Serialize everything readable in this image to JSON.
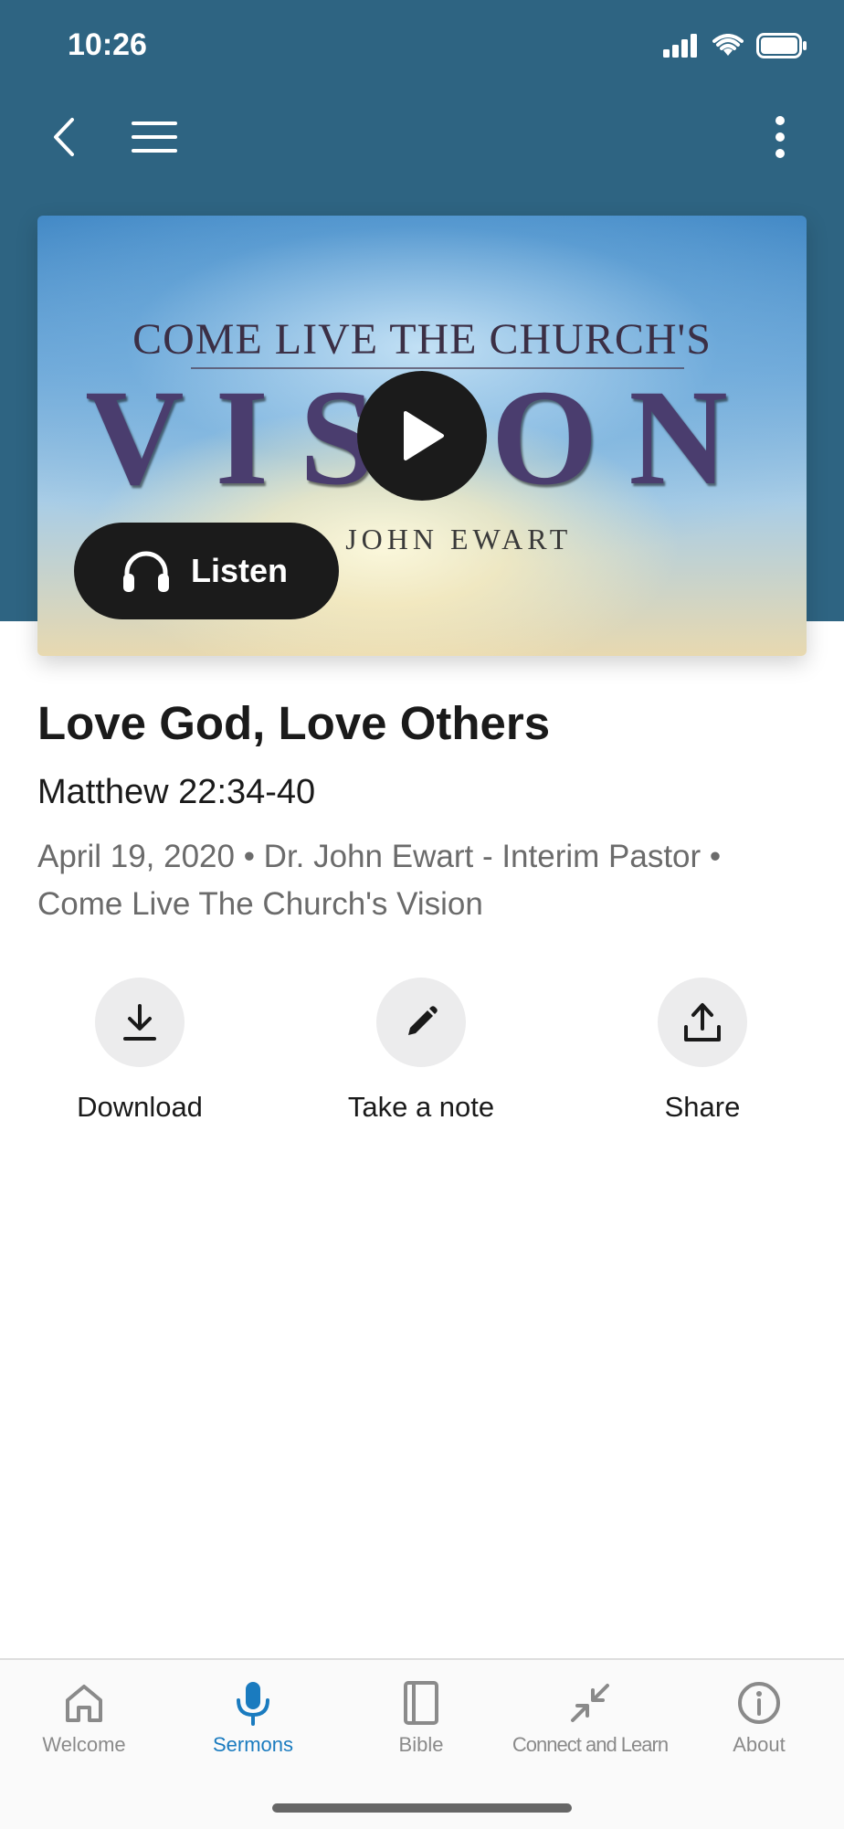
{
  "status_bar": {
    "time": "10:26"
  },
  "hero": {
    "line1": "COME LIVE THE CHURCH'S",
    "line2": "VISION",
    "line3": "DR. JOHN EWART",
    "listen_label": "Listen"
  },
  "sermon": {
    "title": "Love God, Love Others",
    "scripture": "Matthew 22:34-40",
    "meta": "April 19, 2020 • Dr. John Ewart - Interim Pastor • Come Live The Church's Vision"
  },
  "actions": [
    {
      "label": "Download",
      "icon": "download-icon"
    },
    {
      "label": "Take a note",
      "icon": "pencil-icon"
    },
    {
      "label": "Share",
      "icon": "share-icon"
    }
  ],
  "tabs": [
    {
      "label": "Welcome",
      "icon": "home-icon"
    },
    {
      "label": "Sermons",
      "icon": "microphone-icon",
      "active": true
    },
    {
      "label": "Bible",
      "icon": "book-icon"
    },
    {
      "label": "Connect and Learn",
      "icon": "arrows-inward-icon"
    },
    {
      "label": "About",
      "icon": "info-icon"
    }
  ],
  "colors": {
    "header": "#2e6482",
    "active_tab": "#1a7bbf",
    "inactive_tab": "#8a8a8a"
  }
}
